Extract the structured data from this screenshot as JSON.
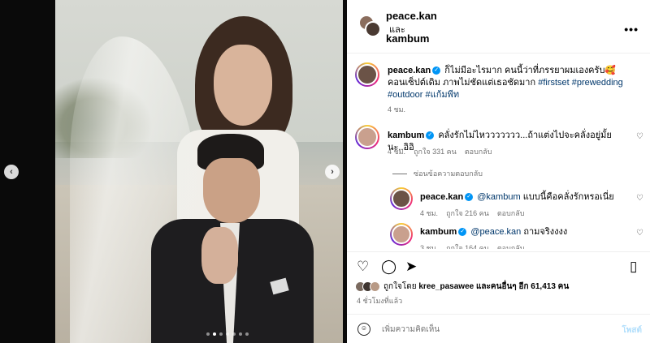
{
  "header": {
    "user1": "peace.kan",
    "and": "และ",
    "user2": "kambum"
  },
  "caption": {
    "user": "peace.kan",
    "text": "ก็ไม่มีอะไรมาก คนนี้ว่าที่ภรรยาผมเองครับ🥰 คอนเซ็ปต์เดิม ภาพไม่ชัดแต่เธอชัดมาก",
    "hashtags": "#firstset #prewedding #outdoor #แก้มพีท",
    "time": "4 ชม."
  },
  "comments": [
    {
      "user": "kambum",
      "text": "คลั่งรักไม่ไหววววววว...ถ้าแต่งไปจะคลั่งอยู่มั้ยนะ..อิอิ",
      "time": "4 ชม.",
      "likes": "ถูกใจ 331 คน",
      "reply": "ตอบกลับ"
    }
  ],
  "replies_toggle": "ซ่อนข้อความตอบกลับ",
  "replies": [
    {
      "user": "peace.kan",
      "mention": "@kambum",
      "text": "แบบนี้คือคลั่งรักหรอเนี่ย",
      "time": "4 ชม.",
      "likes": "ถูกใจ 216 คน",
      "reply": "ตอบกลับ"
    },
    {
      "user": "kambum",
      "mention": "@peace.kan",
      "text": "ถามจริงงงง",
      "time": "3 ชม.",
      "likes": "ถูกใจ 164 คน",
      "reply": "ตอบกลับ"
    }
  ],
  "likes": {
    "prefix": "ถูกใจโดย",
    "user": "kree_pasawee",
    "suffix": "และคนอื่นๆ อีก",
    "count": "61,413",
    "unit": "คน"
  },
  "timestamp": "4 ชั่วโมงที่แล้ว",
  "comment_box": {
    "placeholder": "เพิ่มความคิดเห็น",
    "post_label": "โพสต์"
  },
  "carousel": {
    "total_slides": 7,
    "active_slide": 2
  },
  "icons": {
    "more": "more-horizontal-icon",
    "like": "heart-icon",
    "comment": "comment-icon",
    "share": "send-icon",
    "save": "bookmark-icon",
    "emoji": "emoji-icon",
    "prev": "chevron-left-icon",
    "next": "chevron-right-icon"
  },
  "colors": {
    "link": "#00376b",
    "verified": "#0095f6",
    "muted": "#737373",
    "post_button": "#b2dffc"
  }
}
